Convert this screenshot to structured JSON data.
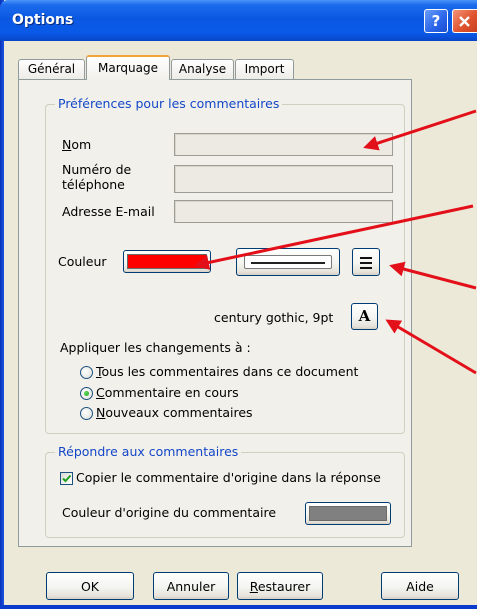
{
  "window": {
    "title": "Options",
    "help_label": "?",
    "close_icon": "close-icon"
  },
  "tabs": [
    {
      "label": "Général",
      "selected": false
    },
    {
      "label": "Marquage",
      "selected": true
    },
    {
      "label": "Analyse",
      "selected": false
    },
    {
      "label": "Import",
      "selected": false
    }
  ],
  "preferences": {
    "group_label": "Préférences pour les commentaires",
    "name": {
      "label": "Nom",
      "value": ""
    },
    "phone": {
      "label": "Numéro de téléphone",
      "value": ""
    },
    "email": {
      "label": "Adresse E-mail",
      "value": ""
    },
    "color": {
      "label": "Couleur",
      "value": "#FF0000"
    },
    "line_style_icon": "line-style-icon",
    "line_width_icon": "lines-icon",
    "font": {
      "text": "century gothic, 9pt",
      "button_label": "A"
    },
    "apply": {
      "label": "Appliquer les changements à :",
      "options": [
        {
          "label": "Tous les commentaires dans ce document",
          "selected": false
        },
        {
          "label": "Commentaire en cours",
          "selected": true
        },
        {
          "label": "Nouveaux commentaires",
          "selected": false
        }
      ]
    }
  },
  "reply": {
    "group_label": "Répondre aux commentaires",
    "copy_original": {
      "label": "Copier le commentaire d'origine dans la réponse",
      "checked": true
    },
    "original_color": {
      "label": "Couleur d'origine du commentaire",
      "value": "#808080"
    }
  },
  "buttons": {
    "ok": "OK",
    "cancel": "Annuler",
    "restore": "Restaurer",
    "help": "Aide"
  },
  "annotations": {
    "arrow_color": "#E3101A"
  }
}
